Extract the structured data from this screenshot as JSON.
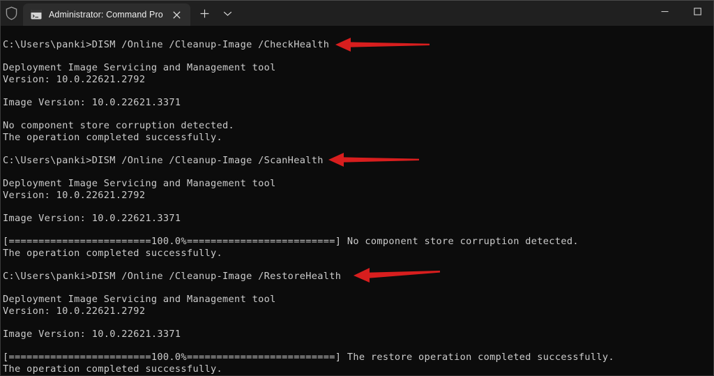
{
  "window": {
    "title_bar": {
      "shield_icon": "shield-icon",
      "minimize_label": "Minimize",
      "maximize_label": "Maximize"
    },
    "tab": {
      "icon": "console-icon",
      "title": "Administrator: Command Pro",
      "close_label": "Close tab"
    },
    "new_tab_label": "New tab",
    "tab_menu_label": "Open new tab dropdown"
  },
  "colors": {
    "titlebar_bg": "#202020",
    "tab_bg": "#2d2d2d",
    "terminal_bg": "#0c0c0c",
    "terminal_fg": "#cccccc",
    "arrow_red": "#d81e1e",
    "window_border": "#3b3b3b"
  },
  "terminal": {
    "prompt": "C:\\Users\\panki>",
    "lines": [
      "C:\\Users\\panki>DISM /Online /Cleanup-Image /CheckHealth",
      "",
      "Deployment Image Servicing and Management tool",
      "Version: 10.0.22621.2792",
      "",
      "Image Version: 10.0.22621.3371",
      "",
      "No component store corruption detected.",
      "The operation completed successfully.",
      "",
      "C:\\Users\\panki>DISM /Online /Cleanup-Image /ScanHealth",
      "",
      "Deployment Image Servicing and Management tool",
      "Version: 10.0.22621.2792",
      "",
      "Image Version: 10.0.22621.3371",
      "",
      "[========================100.0%=========================] No component store corruption detected.",
      "The operation completed successfully.",
      "",
      "C:\\Users\\panki>DISM /Online /Cleanup-Image /RestoreHealth",
      "",
      "Deployment Image Servicing and Management tool",
      "Version: 10.0.22621.2792",
      "",
      "Image Version: 10.0.22621.3371",
      "",
      "[========================100.0%=========================] The restore operation completed successfully.",
      "The operation completed successfully."
    ],
    "commands": [
      "DISM /Online /Cleanup-Image /CheckHealth",
      "DISM /Online /Cleanup-Image /ScanHealth",
      "DISM /Online /Cleanup-Image /RestoreHealth"
    ],
    "progress_percent": "100.0%",
    "tool_name": "Deployment Image Servicing and Management tool",
    "tool_version": "Version: 10.0.22621.2792",
    "image_version": "Image Version: 10.0.22621.3371"
  },
  "annotations": [
    {
      "name": "arrow-checkhealth",
      "points_at": "/CheckHealth"
    },
    {
      "name": "arrow-scanhealth",
      "points_at": "/ScanHealth"
    },
    {
      "name": "arrow-restorehealth",
      "points_at": "/RestoreHealth"
    }
  ]
}
